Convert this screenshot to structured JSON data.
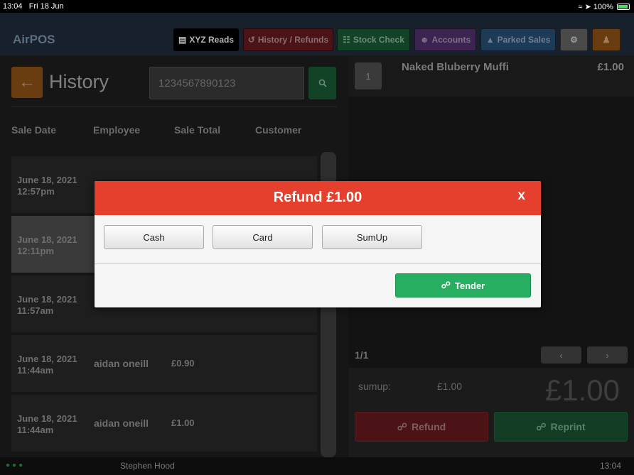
{
  "statusbar": {
    "time": "13:04",
    "date": "Fri 18 Jun",
    "battery": "100%"
  },
  "nav": {
    "brand": "AirPOS",
    "xyz_reads": "XYZ Reads",
    "history_refunds": "History / Refunds",
    "stock_check": "Stock Check",
    "accounts": "Accounts",
    "parked_sales": "Parked Sales",
    "icons": {
      "xyz": "list-icon",
      "history": "history-icon",
      "stock": "barcode-icon",
      "accounts": "users-icon",
      "parked": "car-icon",
      "settings": "gear-icon",
      "user": "user-icon"
    }
  },
  "history": {
    "title": "History",
    "search_value": "1234567890123",
    "columns": [
      "Sale Date",
      "Employee",
      "Sale Total",
      "Customer"
    ],
    "rows": [
      {
        "date": "June 18, 2021",
        "time": "12:57pm",
        "employee": "",
        "total": ""
      },
      {
        "date": "June 18, 2021",
        "time": "12:11pm",
        "employee": "",
        "total": ""
      },
      {
        "date": "June 18, 2021",
        "time": "11:57am",
        "employee": "",
        "total": ""
      },
      {
        "date": "June 18, 2021",
        "time": "11:44am",
        "employee": "aidan oneill",
        "total": "£0.90"
      },
      {
        "date": "June 18, 2021",
        "time": "11:44am",
        "employee": "aidan oneill",
        "total": "£1.00"
      }
    ]
  },
  "sale": {
    "qty": "1",
    "item_name": "Naked Bluberry Muffi",
    "item_price": "£1.00",
    "page": "1/1",
    "payment_method": "sumup:",
    "payment_amount": "£1.00",
    "total": "£1.00",
    "refund_label": "Refund",
    "reprint_label": "Reprint"
  },
  "footer": {
    "user": "Stephen Hood",
    "time": "13:04"
  },
  "modal": {
    "title": "Refund £1.00",
    "close": "x",
    "methods": [
      "Cash",
      "Card",
      "SumUp"
    ],
    "tender_label": "Tender"
  },
  "colors": {
    "modal_header": "#e53f2d",
    "tender": "#27ae60"
  }
}
